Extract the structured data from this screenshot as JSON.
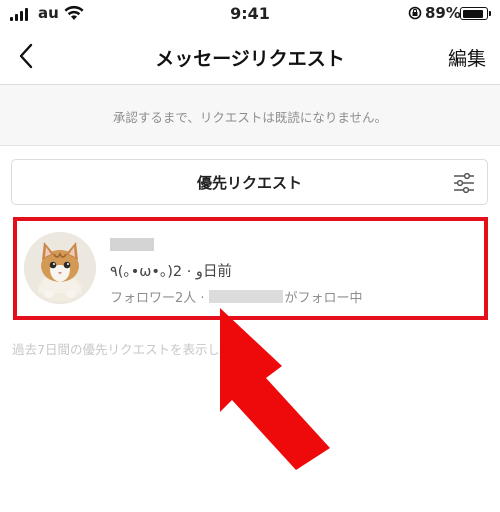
{
  "status_bar": {
    "carrier": "au",
    "time": "9:41",
    "battery": "89%",
    "battery_level": 0.89
  },
  "nav": {
    "title": "メッセージリクエスト",
    "edit_label": "編集",
    "back_icon": "chevron-left-icon"
  },
  "info": {
    "text": "承認するまで、リクエストは既読になりません。"
  },
  "priority": {
    "label": "優先リクエスト",
    "filter_icon": "sliders-icon"
  },
  "request": {
    "message": "٩(｡•ω•｡)و",
    "time_ago": "· 2日前",
    "followers": "フォロワー2人 ·",
    "followed_suffix": "がフォロー中"
  },
  "footer_note": "過去7日間の優先リクエストを表示しています。",
  "colors": {
    "highlight": "#e3101b",
    "text_gray": "#8e8e8e",
    "divider": "#dbdbdb"
  }
}
